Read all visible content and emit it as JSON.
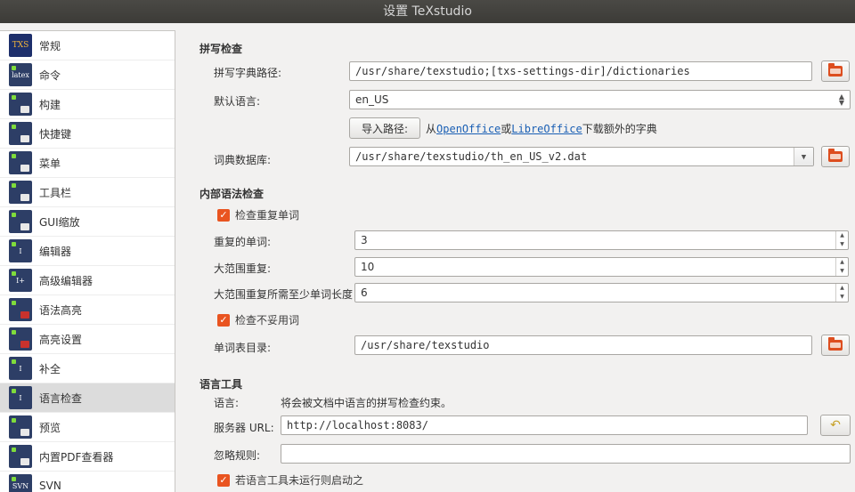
{
  "window": {
    "title": "设置 TeXstudio"
  },
  "sidebar": {
    "items": [
      {
        "label": "常规",
        "icon": "txs-logo-icon"
      },
      {
        "label": "命令",
        "icon": "latex-icon"
      },
      {
        "label": "构建",
        "icon": "build-icon"
      },
      {
        "label": "快捷键",
        "icon": "keyboard-icon"
      },
      {
        "label": "菜单",
        "icon": "menu-icon"
      },
      {
        "label": "工具栏",
        "icon": "toolbar-icon"
      },
      {
        "label": "GUI缩放",
        "icon": "gui-scale-icon"
      },
      {
        "label": "编辑器",
        "icon": "editor-icon"
      },
      {
        "label": "高级编辑器",
        "icon": "advanced-editor-icon"
      },
      {
        "label": "语法高亮",
        "icon": "syntax-highlight-icon"
      },
      {
        "label": "高亮设置",
        "icon": "highlight-settings-icon"
      },
      {
        "label": "补全",
        "icon": "completion-icon"
      },
      {
        "label": "语言检查",
        "icon": "language-check-icon",
        "selected": true
      },
      {
        "label": "预览",
        "icon": "preview-icon"
      },
      {
        "label": "内置PDF查看器",
        "icon": "pdf-viewer-icon"
      },
      {
        "label": "SVN",
        "icon": "svn-icon"
      }
    ]
  },
  "spell": {
    "title": "拼写检查",
    "dict_path_label": "拼写字典路径:",
    "dict_path_value": "/usr/share/texstudio;[txs-settings-dir]/dictionaries",
    "default_lang_label": "默认语言:",
    "default_lang_value": "en_US",
    "import_button": "导入路径:",
    "import_note_prefix": "从",
    "openoffice": "OpenOffice",
    "or": "或",
    "libreoffice": "LibreOffice",
    "import_note_suffix": "下载额外的字典",
    "thesaurus_label": "词典数据库:",
    "thesaurus_value": "/usr/share/texstudio/th_en_US_v2.dat"
  },
  "grammar": {
    "title": "内部语法检查",
    "check_repeat": "检查重复单词",
    "repeat_words_label": "重复的单词:",
    "repeat_words_value": "3",
    "long_range_label": "大范围重复:",
    "long_range_value": "10",
    "min_word_len_label": "大范围重复所需至少单词长度",
    "min_word_len_value": "6",
    "check_bad": "检查不妥用词",
    "wordlist_dir_label": "单词表目录:",
    "wordlist_dir_value": "/usr/share/texstudio"
  },
  "langtool": {
    "title": "语言工具",
    "lang_label": "语言:",
    "lang_note": "将会被文档中语言的拼写检查约束。",
    "server_label": "服务器 URL:",
    "server_value": "http://localhost:8083/",
    "ignore_label": "忽略规则:",
    "ignore_value": "",
    "autostart": "若语言工具未运行则启动之"
  },
  "colors": {
    "accent": "#e95420",
    "link": "#1a5fb4",
    "titlebar": "#3c3b37"
  }
}
